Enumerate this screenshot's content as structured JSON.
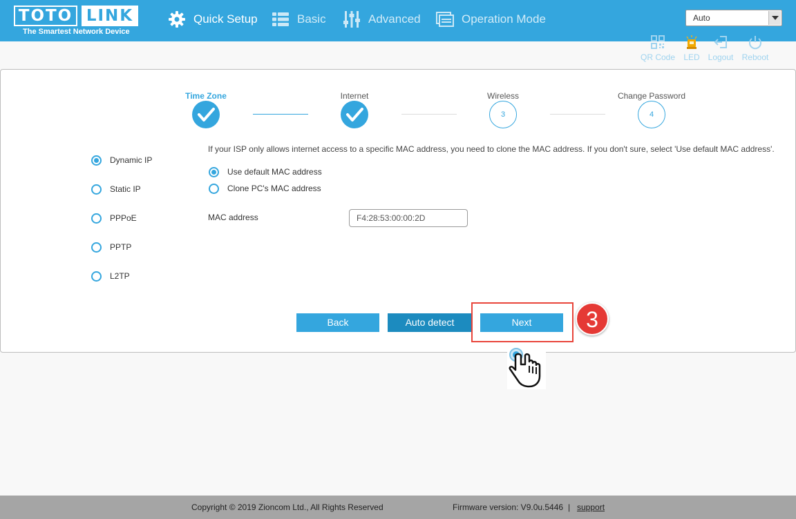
{
  "header": {
    "logo_left": "TOTO",
    "logo_right": "LINK",
    "tagline": "The Smartest Network Device",
    "nav": [
      {
        "label": "Quick Setup",
        "icon": "gear-icon",
        "active": true
      },
      {
        "label": "Basic",
        "icon": "list-icon",
        "active": false
      },
      {
        "label": "Advanced",
        "icon": "sliders-icon",
        "active": false
      },
      {
        "label": "Operation Mode",
        "icon": "window-icon",
        "active": false
      }
    ],
    "language": "Auto"
  },
  "utilities": [
    {
      "label": "QR Code",
      "icon": "qr-code-icon"
    },
    {
      "label": "LED",
      "icon": "led-icon"
    },
    {
      "label": "Logout",
      "icon": "logout-icon"
    },
    {
      "label": "Reboot",
      "icon": "power-icon"
    }
  ],
  "steps": [
    {
      "label": "Time Zone",
      "state": "done",
      "active": true
    },
    {
      "label": "Internet",
      "state": "done",
      "active": false
    },
    {
      "label": "Wireless",
      "number": "3",
      "state": "todo"
    },
    {
      "label": "Change Password",
      "number": "4",
      "state": "todo"
    }
  ],
  "connection_types": [
    {
      "label": "Dynamic IP",
      "checked": true
    },
    {
      "label": "Static IP",
      "checked": false
    },
    {
      "label": "PPPoE",
      "checked": false
    },
    {
      "label": "PPTP",
      "checked": false
    },
    {
      "label": "L2TP",
      "checked": false
    }
  ],
  "description": "If your ISP only allows internet access to a specific MAC address, you need to clone the MAC address. If you don't sure, select 'Use default MAC address'.",
  "mac_options": [
    {
      "label": "Use default MAC address",
      "checked": true
    },
    {
      "label": "Clone PC's MAC address",
      "checked": false
    }
  ],
  "mac": {
    "label": "MAC address",
    "value": "F4:28:53:00:00:2D"
  },
  "buttons": {
    "back": "Back",
    "auto_detect": "Auto detect",
    "next": "Next"
  },
  "annotation": {
    "step_number": "3",
    "highlight_color": "#e8443a",
    "badge_color": "#e53935"
  },
  "colors": {
    "accent": "#34a6de",
    "header": "#34a6de",
    "footer": "#a5a5a5"
  },
  "footer": {
    "copyright": "Copyright © 2019 Zioncom Ltd., All Rights Reserved",
    "firmware": "Firmware version: V9.0u.5446",
    "separator": "|",
    "support": "support"
  }
}
